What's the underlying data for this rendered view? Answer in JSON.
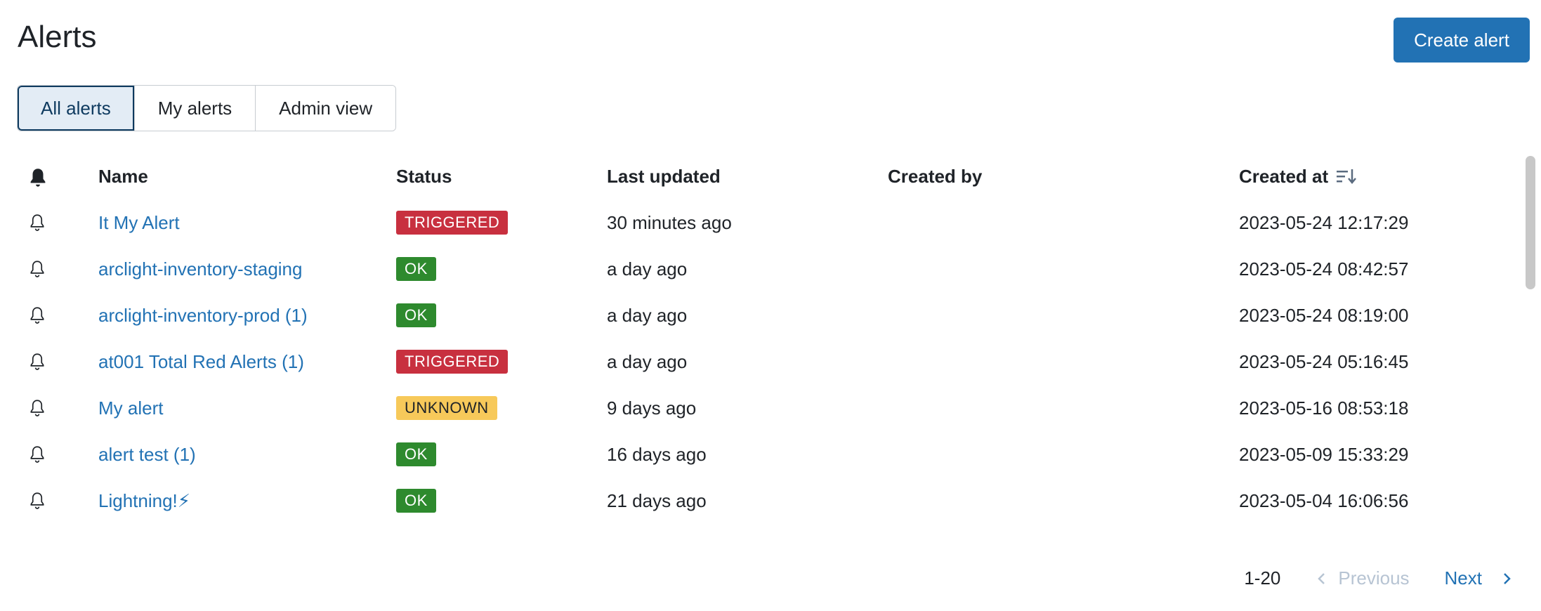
{
  "page": {
    "title": "Alerts",
    "create_button": "Create alert"
  },
  "tabs": [
    {
      "label": "All alerts",
      "active": true
    },
    {
      "label": "My alerts",
      "active": false
    },
    {
      "label": "Admin view",
      "active": false
    }
  ],
  "table": {
    "headers": {
      "bell": "bell-icon",
      "name": "Name",
      "status": "Status",
      "last_updated": "Last updated",
      "created_by": "Created by",
      "created_at": "Created at"
    },
    "rows": [
      {
        "name": "It My Alert",
        "status": "TRIGGERED",
        "last_updated": "30 minutes ago",
        "created_by": "",
        "created_at": "2023-05-24 12:17:29"
      },
      {
        "name": "arclight-inventory-staging",
        "status": "OK",
        "last_updated": "a day ago",
        "created_by": "",
        "created_at": "2023-05-24 08:42:57"
      },
      {
        "name": "arclight-inventory-prod (1)",
        "status": "OK",
        "last_updated": "a day ago",
        "created_by": "",
        "created_at": "2023-05-24 08:19:00"
      },
      {
        "name": "at001 Total Red Alerts (1)",
        "status": "TRIGGERED",
        "last_updated": "a day ago",
        "created_by": "",
        "created_at": "2023-05-24 05:16:45"
      },
      {
        "name": "My alert",
        "status": "UNKNOWN",
        "last_updated": "9 days ago",
        "created_by": "",
        "created_at": "2023-05-16 08:53:18"
      },
      {
        "name": "alert test (1)",
        "status": "OK",
        "last_updated": "16 days ago",
        "created_by": "",
        "created_at": "2023-05-09 15:33:29"
      },
      {
        "name": "Lightning!⚡",
        "status": "OK",
        "last_updated": "21 days ago",
        "created_by": "",
        "created_at": "2023-05-04 16:06:56"
      }
    ]
  },
  "status_colors": {
    "TRIGGERED": {
      "bg": "#c8303f",
      "fg": "#ffffff"
    },
    "OK": {
      "bg": "#2e8a2e",
      "fg": "#ffffff"
    },
    "UNKNOWN": {
      "bg": "#f7c95a",
      "fg": "#1f2328"
    }
  },
  "pagination": {
    "range": "1-20",
    "previous": "Previous",
    "next": "Next"
  },
  "colors": {
    "accent": "#2272b4",
    "link": "#2272b4"
  }
}
